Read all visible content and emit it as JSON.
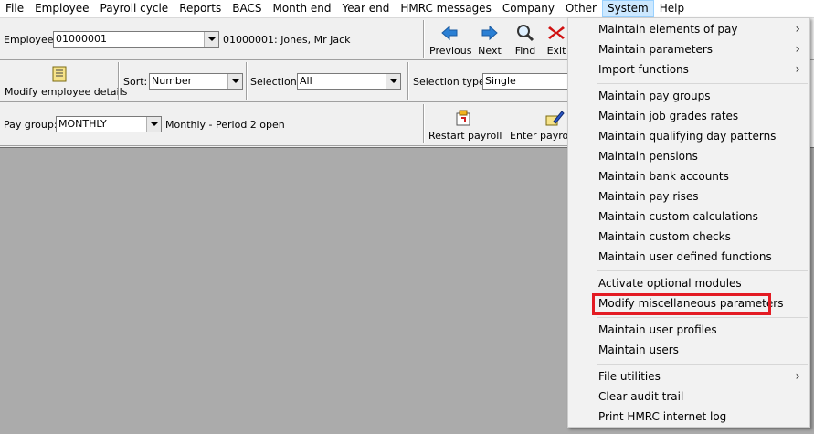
{
  "menubar": [
    "File",
    "Employee",
    "Payroll cycle",
    "Reports",
    "BACS",
    "Month end",
    "Year end",
    "HMRC messages",
    "Company",
    "Other",
    "System",
    "Help"
  ],
  "active_menu": "System",
  "row1": {
    "employee_label": "Employee:",
    "employee_value": "01000001",
    "employee_desc": "01000001: Jones, Mr Jack",
    "previous": "Previous",
    "next": "Next",
    "find": "Find",
    "exit": "Exit"
  },
  "row2": {
    "modify_employee": "Modify employee details",
    "sort_label": "Sort:",
    "sort_value": "Number",
    "selection_label": "Selection:",
    "selection_value": "All",
    "selection_type_label": "Selection type:",
    "selection_type_value": "Single"
  },
  "row3": {
    "pay_group_label": "Pay group:",
    "pay_group_value": "MONTHLY",
    "period_text": "Monthly - Period 2 open",
    "restart_payroll": "Restart payroll",
    "enter_payroll": "Enter payrol"
  },
  "system_menu": {
    "items": [
      {
        "label": "Maintain elements of pay",
        "submenu": true
      },
      {
        "label": "Maintain parameters",
        "submenu": true
      },
      {
        "label": "Import functions",
        "submenu": true
      },
      {
        "label": "Maintain pay groups"
      },
      {
        "label": "Maintain job grades rates"
      },
      {
        "label": "Maintain qualifying day patterns"
      },
      {
        "label": "Maintain pensions"
      },
      {
        "label": "Maintain bank accounts"
      },
      {
        "label": "Maintain pay rises"
      },
      {
        "label": "Maintain custom calculations"
      },
      {
        "label": "Maintain custom checks"
      },
      {
        "label": "Maintain user defined functions"
      },
      {
        "label": "Activate optional modules"
      },
      {
        "label": "Modify miscellaneous parameters",
        "highlighted": true
      },
      {
        "label": "Maintain user profiles"
      },
      {
        "label": "Maintain users"
      },
      {
        "label": "File utilities",
        "submenu": true
      },
      {
        "label": "Clear audit trail"
      },
      {
        "label": "Print HMRC internet log"
      }
    ]
  },
  "colors": {
    "highlight_border": "#e31b23",
    "active_menu_bg": "#cce8ff",
    "main_area_bg": "#ababab"
  }
}
